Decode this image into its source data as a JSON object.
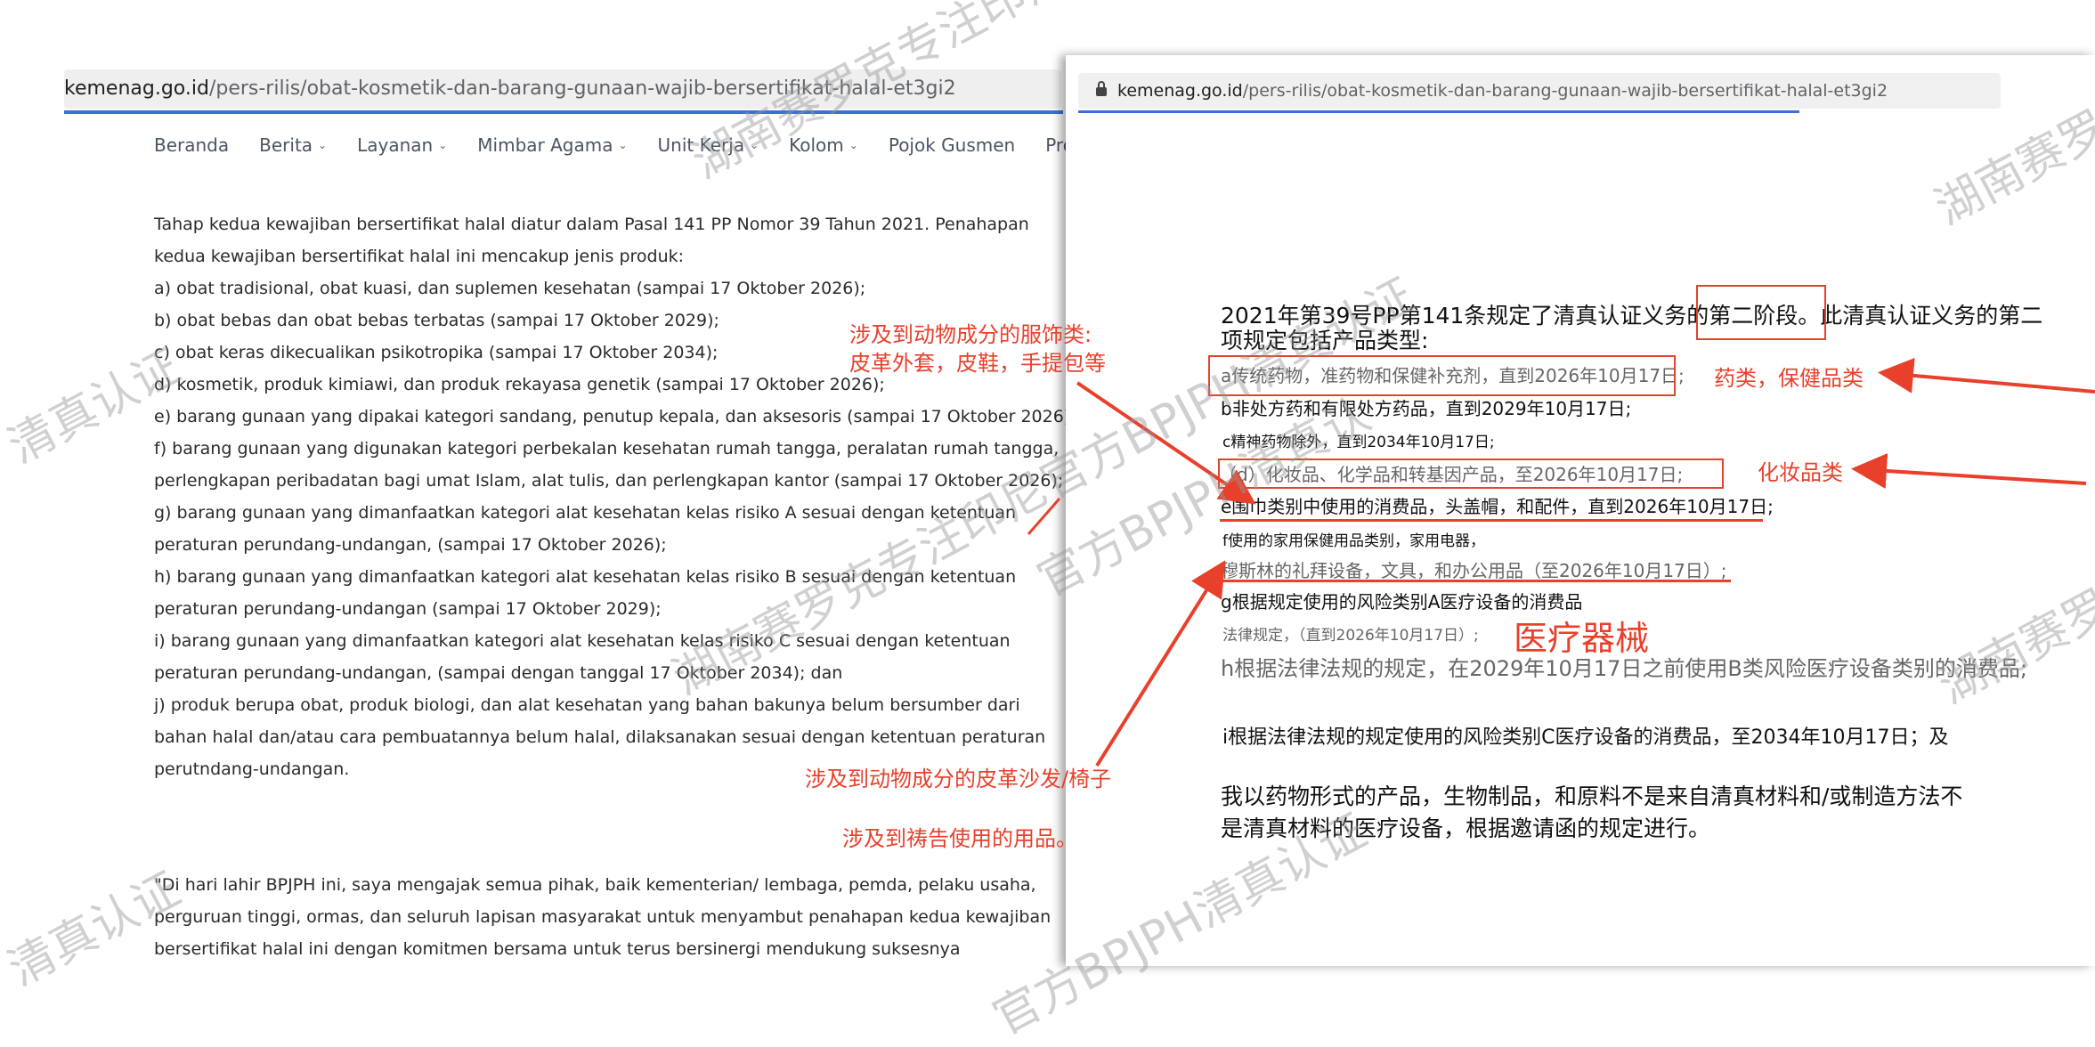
{
  "left": {
    "url_domain": "kemenag.go.id",
    "url_path": "/pers-rilis/obat-kosmetik-dan-barang-gunaan-wajib-bersertifikat-halal-et3gi2",
    "nav": [
      "Beranda",
      "Berita",
      "Layanan",
      "Mimbar Agama",
      "Unit Kerja",
      "Kolom",
      "Pojok Gusmen",
      "Profil"
    ],
    "body_lines": [
      "Tahap kedua kewajiban bersertifikat halal diatur dalam Pasal 141 PP Nomor 39 Tahun 2021. Penahapan",
      "kedua kewajiban bersertifikat halal ini mencakup jenis produk:",
      "a) obat tradisional, obat kuasi, dan suplemen kesehatan (sampai 17 Oktober 2026);",
      "b) obat bebas dan obat bebas terbatas (sampai 17 Oktober 2029);",
      "c) obat keras dikecualikan psikotropika (sampai 17 Oktober 2034);",
      "d) kosmetik, produk kimiawi, dan produk rekayasa genetik (sampai 17 Oktober 2026);",
      "e) barang gunaan yang dipakai kategori sandang, penutup kepala, dan aksesoris (sampai 17 Oktober 2026);",
      "f) barang gunaan yang digunakan kategori perbekalan kesehatan rumah tangga, peralatan rumah tangga,",
      "perlengkapan peribadatan bagi umat Islam, alat tulis, dan perlengkapan kantor (sampai 17 Oktober 2026);",
      "g) barang gunaan yang dimanfaatkan kategori alat kesehatan kelas risiko A sesuai dengan ketentuan",
      "peraturan perundang-undangan, (sampai 17 Oktober 2026);",
      "h) barang gunaan yang dimanfaatkan kategori alat kesehatan kelas risiko B sesuai dengan ketentuan",
      "peraturan perundang-undangan (sampai 17 Oktober 2029);",
      "i) barang gunaan yang dimanfaatkan kategori alat kesehatan kelas risiko C sesuai dengan ketentuan",
      "peraturan perundang-undangan, (sampai dengan tanggal 17 Oktober 2034); dan",
      "j) produk berupa obat, produk biologi, dan alat kesehatan yang bahan bakunya belum bersumber dari",
      "bahan halal dan/atau cara pembuatannya belum halal, dilaksanakan sesuai dengan ketentuan peraturan",
      "perutndang-undangan."
    ],
    "quote_lines": [
      "\"Di hari lahir BPJPH ini, saya mengajak semua pihak, baik kementerian/ lembaga, pemda, pelaku usaha,",
      "perguruan tinggi, ormas, dan seluruh lapisan masyarakat untuk menyambut penahapan kedua kewajiban",
      "bersertifikat halal ini dengan komitmen bersama untuk terus bersinergi mendukung suksesnya"
    ]
  },
  "right": {
    "url_domain": "kemenag.go.id",
    "url_path": "/pers-rilis/obat-kosmetik-dan-barang-gunaan-wajib-bersertifikat-halal-et3gi2",
    "intro_line1": "2021年第39号PP第141条规定了清真认证义务的第二阶段。此清真认证义务的第二",
    "intro_line2": "项规定包括产品类型:",
    "item_a": "a传统药物，准药物和保健补充剂，直到2026年10月17日;",
    "item_b": "b非处方药和有限处方药品，直到2029年10月17日;",
    "item_c": "c精神药物除外，直到2034年10月17日;",
    "item_d": "（d）化妆品、化学品和转基因产品，至2026年10月17日;",
    "item_e": "e围巾类别中使用的消费品，头盖帽，和配件，直到2026年10月17日;",
    "item_f1": "f使用的家用保健用品类别，家用电器，",
    "item_f2": "穆斯林的礼拜设备，文具，和办公用品（至2026年10月17日）;",
    "item_g1": "g根据规定使用的风险类别A医疗设备的消费品",
    "item_g2": "法律规定，（直到2026年10月17日）;",
    "item_h": "h根据法律法规的规定，在2029年10月17日之前使用B类风险医疗设备类别的消费品;",
    "item_i": "i根据法律法规的规定使用的风险类别C医疗设备的消费品，至2034年10月17日；及",
    "item_j1": "我以药物形式的产品，生物制品，和原料不是来自清真材料和/或制造方法不",
    "item_j2": "是清真材料的医疗设备，根据邀请函的规定进行。"
  },
  "annotations": {
    "apparel_line1": "涉及到动物成分的服饰类:",
    "apparel_line2": "皮革外套，皮鞋，手提包等",
    "furniture": "涉及到动物成分的皮革沙发/椅子",
    "prayer": "涉及到祷告使用的用品。",
    "pharma": "药类，保健品类",
    "cosmetics": "化妆品类",
    "medical": "医疗器械",
    "color": "#e8402b"
  },
  "watermarks": {
    "w1": "湖南赛罗克专注印尼",
    "w2": "清真认证",
    "w3": "官方BPJPH清真认",
    "w4": "湖南赛罗克专注印尼官方BPJPH清真认证",
    "w5": "清真认证",
    "w6": "官方BPJPH清真认证",
    "w7": "湖南赛罗",
    "w8": "湖南赛罗"
  }
}
